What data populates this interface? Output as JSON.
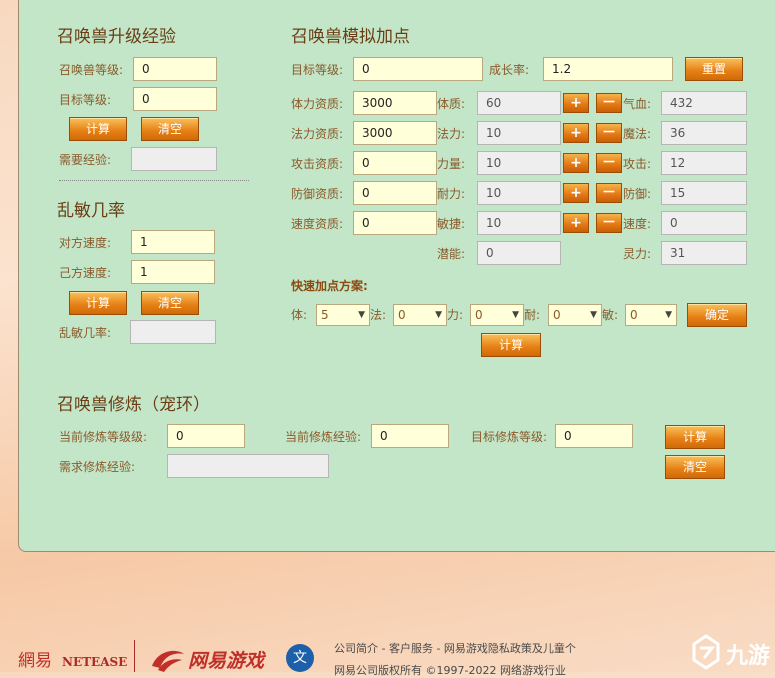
{
  "levelup": {
    "title": "召唤兽升级经验",
    "pet_level_label": "召唤兽等级:",
    "pet_level_value": "0",
    "target_level_label": "目标等级:",
    "target_level_value": "0",
    "calc": "计算",
    "clear": "清空",
    "need_exp_label": "需要经验:",
    "need_exp_value": ""
  },
  "speed": {
    "title": "乱敏几率",
    "enemy_speed_label": "对方速度:",
    "enemy_speed_value": "1",
    "own_speed_label": "己方速度:",
    "own_speed_value": "1",
    "calc": "计算",
    "clear": "清空",
    "rate_label": "乱敏几率:",
    "rate_value": ""
  },
  "sim": {
    "title": "召唤兽模拟加点",
    "target_level_label": "目标等级:",
    "target_level_value": "0",
    "growth_label": "成长率:",
    "growth_value": "1.2",
    "reset": "重置",
    "rows": [
      {
        "apt_label": "体力资质:",
        "apt_value": "3000",
        "attr_label": "体质:",
        "attr_value": "60",
        "res_label": "气血:",
        "res_value": "432"
      },
      {
        "apt_label": "法力资质:",
        "apt_value": "3000",
        "attr_label": "法力:",
        "attr_value": "10",
        "res_label": "魔法:",
        "res_value": "36"
      },
      {
        "apt_label": "攻击资质:",
        "apt_value": "0",
        "attr_label": "力量:",
        "attr_value": "10",
        "res_label": "攻击:",
        "res_value": "12"
      },
      {
        "apt_label": "防御资质:",
        "apt_value": "0",
        "attr_label": "耐力:",
        "attr_value": "10",
        "res_label": "防御:",
        "res_value": "15"
      },
      {
        "apt_label": "速度资质:",
        "apt_value": "0",
        "attr_label": "敏捷:",
        "attr_value": "10",
        "res_label": "速度:",
        "res_value": "0"
      }
    ],
    "plus": "+",
    "minus": "－",
    "potential_label": "潜能:",
    "potential_value": "0",
    "spirit_label": "灵力:",
    "spirit_value": "31",
    "quick_title": "快速加点方案:",
    "quick": [
      {
        "label": "体:",
        "value": "5"
      },
      {
        "label": "法:",
        "value": "0"
      },
      {
        "label": "力:",
        "value": "0"
      },
      {
        "label": "耐:",
        "value": "0"
      },
      {
        "label": "敏:",
        "value": "0"
      }
    ],
    "confirm": "确定",
    "calc": "计算"
  },
  "train": {
    "title": "召唤兽修炼（宠环）",
    "cur_level_label": "当前修炼等级级:",
    "cur_level_value": "0",
    "cur_exp_label": "当前修炼经验:",
    "cur_exp_value": "0",
    "target_level_label": "目标修炼等级:",
    "target_level_value": "0",
    "need_exp_label": "需求修炼经验:",
    "need_exp_value": "",
    "calc": "计算",
    "clear": "清空"
  },
  "footer": {
    "netease_cn": "網易",
    "netease_en": "NETEASE",
    "games_logo": "网易游戏",
    "badge": "文",
    "links": "公司简介 - 客户服务 - 网易游戏隐私政策及儿童个",
    "copyright": "网易公司版权所有 ©1997-2022    网络游戏行业",
    "watermark": "九游"
  },
  "colors": {
    "panel": "#c3e6c8",
    "button": "#e57f14",
    "input": "#ffffd9"
  }
}
